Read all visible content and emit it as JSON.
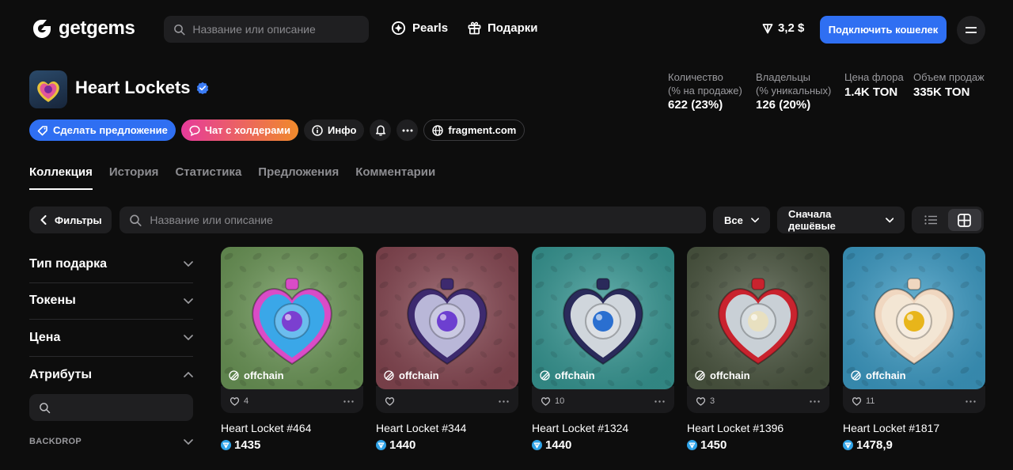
{
  "header": {
    "logo_text": "getgems",
    "search_placeholder": "Название или описание",
    "pearls_label": "Pearls",
    "gifts_label": "Подарки",
    "balance": "3,2 $",
    "connect_label": "Подключить кошелек"
  },
  "collection": {
    "title": "Heart Lockets",
    "stats": [
      {
        "label1": "Количество",
        "label2": "(% на продаже)",
        "value": "622 (23%)"
      },
      {
        "label1": "Владельцы",
        "label2": "(% уникальных)",
        "value": "126 (20%)"
      },
      {
        "label1": "Цена флора",
        "label2": "",
        "value": "1.4K TON"
      },
      {
        "label1": "Объем продаж",
        "label2": "",
        "value": "335K TON"
      }
    ],
    "actions": {
      "offer": "Сделать предложение",
      "chat": "Чат с холдерами",
      "info": "Инфо",
      "site": "fragment.com"
    }
  },
  "tabs": [
    "Коллекция",
    "История",
    "Статистика",
    "Предложения",
    "Комментарии"
  ],
  "filters": {
    "filters_label": "Фильтры",
    "search_placeholder": "Название или описание",
    "all_label": "Все",
    "sort_label": "Сначала дешёвые"
  },
  "sidebar": {
    "sections": [
      "Тип подарка",
      "Токены",
      "Цена",
      "Атрибуты"
    ],
    "sub": "BACKDROP"
  },
  "cards": [
    {
      "name": "Heart Locket #464",
      "price": "1435",
      "likes": "4",
      "badge": "offchain",
      "bg": "#6f9a5a",
      "heart": "#3aa7e8",
      "rim": "#d94cc7",
      "gem": "#7b3fd0"
    },
    {
      "name": "Heart Locket #344",
      "price": "1440",
      "likes": "",
      "badge": "offchain",
      "bg": "#8a4a55",
      "heart": "#b9b7d8",
      "rim": "#3d2a6e",
      "gem": "#6d3fd0"
    },
    {
      "name": "Heart Locket #1324",
      "price": "1440",
      "likes": "10",
      "badge": "offchain",
      "bg": "#3a9c98",
      "heart": "#d0d6dc",
      "rim": "#2a2a5a",
      "gem": "#2a6fd0"
    },
    {
      "name": "Heart Locket #1396",
      "price": "1450",
      "likes": "3",
      "badge": "offchain",
      "bg": "#4f5a44",
      "heart": "#c9d0d6",
      "rim": "#c9232e",
      "gem": "#e8e0c0"
    },
    {
      "name": "Heart Locket #1817",
      "price": "1478,9",
      "likes": "11",
      "badge": "offchain",
      "bg": "#3f9fc9",
      "heart": "#f3e6d4",
      "rim": "#f0d7c0",
      "gem": "#e8b51a"
    }
  ]
}
